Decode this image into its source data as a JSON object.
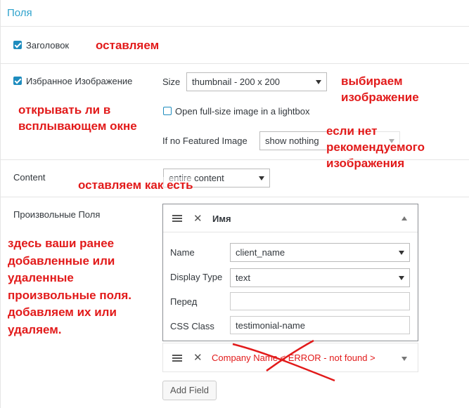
{
  "header": {
    "title": "Поля"
  },
  "rows": {
    "title": {
      "label": "Заголовок",
      "checked": true
    },
    "featured": {
      "label": "Избранное Изображение",
      "size_label": "Size",
      "size_value": "thumbnail - 200 x 200",
      "lightbox_label": "Open full-size image in a lightbox",
      "lightbox_checked": false,
      "nofeat_label": "If no Featured Image",
      "nofeat_value": "show nothing",
      "checked": true
    },
    "content": {
      "label": "Content",
      "value": "entire content"
    },
    "custom": {
      "label": "Произвольные Поля"
    }
  },
  "field1": {
    "title": "Имя",
    "name_label": "Name",
    "name_value": "client_name",
    "display_label": "Display Type",
    "display_value": "text",
    "before_label": "Перед",
    "before_value": "",
    "css_label": "CSS Class",
    "css_value": "testimonial-name"
  },
  "field2": {
    "title": "Company Name < ERROR - not found >"
  },
  "add_field": "Add Field",
  "annotations": {
    "a1": "оставляем",
    "a2": "выбираем\nизображение",
    "a3": "открывать ли в\nвсплывающем окне",
    "a4": "если нет\nрекомендуемого\nизображения",
    "a5": "оставляем как есть",
    "a6": "здесь ваши ранее\nдобавленные или\nудаленные\nпроизвольные поля.\nдобавляем их или\nудаляем."
  },
  "colors": {
    "accent": "#1e8cbe",
    "link": "#2ea2cc",
    "annotation": "#e21a1a"
  }
}
